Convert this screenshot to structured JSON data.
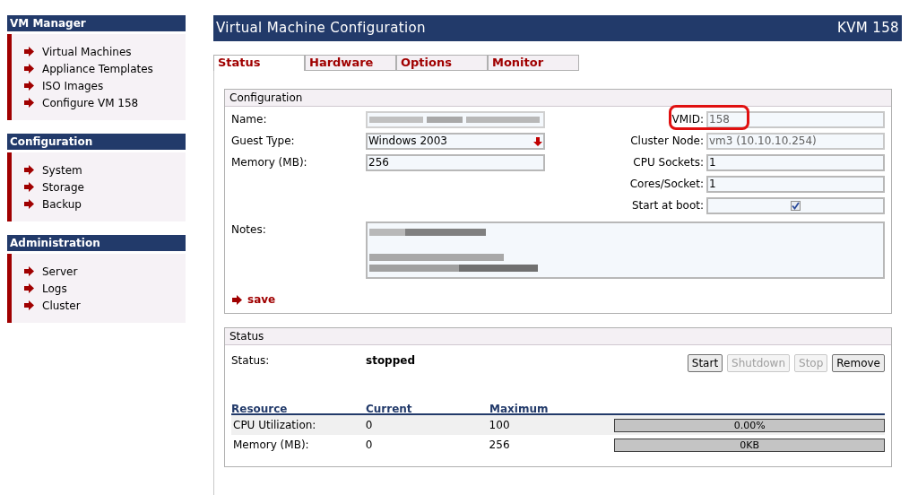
{
  "sidebar": {
    "sections": [
      {
        "title": "VM Manager",
        "items": [
          "Virtual Machines",
          "Appliance Templates",
          "ISO Images",
          "Configure VM 158"
        ]
      },
      {
        "title": "Configuration",
        "items": [
          "System",
          "Storage",
          "Backup"
        ]
      },
      {
        "title": "Administration",
        "items": [
          "Server",
          "Logs",
          "Cluster"
        ]
      }
    ]
  },
  "header": {
    "title": "Virtual Machine Configuration",
    "vm": "KVM 158"
  },
  "tabs": [
    {
      "label": "Status",
      "selected": true
    },
    {
      "label": "Hardware",
      "selected": false
    },
    {
      "label": "Options",
      "selected": false
    },
    {
      "label": "Monitor",
      "selected": false
    }
  ],
  "configuration": {
    "title": "Configuration",
    "left_fields": [
      {
        "label": "Name:",
        "kind": "redacted"
      },
      {
        "label": "Guest Type:",
        "kind": "select",
        "value": "Windows 2003"
      },
      {
        "label": "Memory (MB):",
        "kind": "text",
        "value": "256"
      }
    ],
    "right_fields": [
      {
        "label": "VMID:",
        "kind": "readonly",
        "value": "158",
        "highlighted": true
      },
      {
        "label": "Cluster Node:",
        "kind": "readonly",
        "value": "vm3 (10.10.10.254)",
        "highlighted": false
      },
      {
        "label": "CPU Sockets:",
        "kind": "text",
        "value": "1",
        "highlighted": false
      },
      {
        "label": "Cores/Socket:",
        "kind": "text",
        "value": "1",
        "highlighted": false
      },
      {
        "label": "Start at boot:",
        "kind": "checkbox",
        "checked": true,
        "highlighted": false
      }
    ],
    "notes_label": "Notes:",
    "save": "save"
  },
  "status": {
    "title": "Status",
    "status_label": "Status:",
    "status_value": "stopped",
    "buttons": [
      {
        "label": "Start",
        "disabled": false
      },
      {
        "label": "Shutdown",
        "disabled": true
      },
      {
        "label": "Stop",
        "disabled": true
      },
      {
        "label": "Remove",
        "disabled": false
      }
    ],
    "columns": [
      "Resource",
      "Current",
      "Maximum"
    ],
    "rows": [
      {
        "resource": "CPU Utilization:",
        "current": "0",
        "maximum": "100",
        "level": 0,
        "reading": "0.00%"
      },
      {
        "resource": "Memory (MB):",
        "current": "0",
        "maximum": "256",
        "level": 0,
        "reading": "0KB"
      }
    ]
  }
}
